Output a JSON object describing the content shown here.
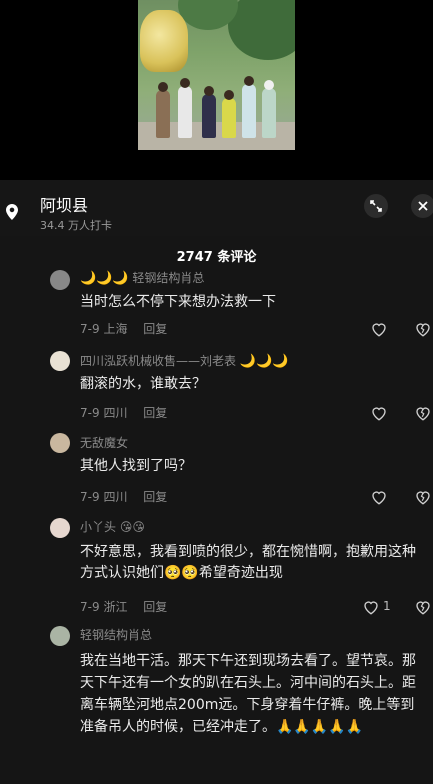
{
  "location": {
    "name": "阿坝县",
    "checkins": "34.4 万人打卡"
  },
  "panel": {
    "title": "2747 条评论"
  },
  "comments": [
    {
      "username": "轻钢结构肖总",
      "username_prefix_emojis": "🌙🌙🌙",
      "text": "当时怎么不停下来想办法救一下",
      "date": "7-9",
      "region": "上海",
      "reply_label": "回复"
    },
    {
      "username": "四川泓跃机械收售——刘老表",
      "username_suffix_emojis": "🌙🌙🌙",
      "text": "翻滚的水，谁敢去？",
      "date": "7-9",
      "region": "四川",
      "reply_label": "回复"
    },
    {
      "username": "无敌魔女",
      "text": "其他人找到了吗？",
      "date": "7-9",
      "region": "四川",
      "reply_label": "回复"
    },
    {
      "username": "小丫头",
      "username_suffix_emojis": "😘😘",
      "text_part1": "不好意思，我看到喷的很少，都在惋惜啊，抱歉用这种方式认识她们",
      "text_emojis": "🥺🥺",
      "text_part2": "希望奇迹出现",
      "date": "7-9",
      "region": "浙江",
      "reply_label": "回复",
      "likes": "1"
    },
    {
      "username": "轻钢结构肖总",
      "text": "我在当地干活。那天下午还到现场去看了。望节哀。那天下午还有一个女的趴在石头上。河中间的石头上。距离车辆坠河地点200m远。下身穿着牛仔裤。晚上等到准备吊人的时候，已经冲走了。",
      "text_emojis": "🙏🙏🙏🙏🙏"
    }
  ]
}
